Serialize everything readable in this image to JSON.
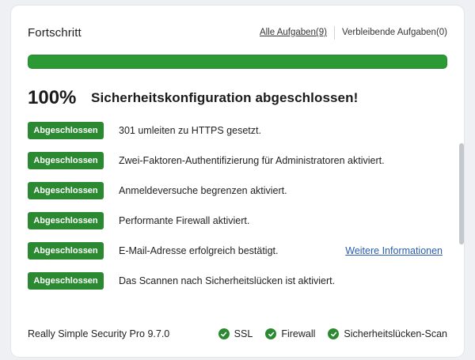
{
  "header": {
    "title": "Fortschritt",
    "filter_all": "Alle Aufgaben(9)",
    "filter_remaining": "Verbleibende Aufgaben(0)"
  },
  "progress": {
    "value_percent": 100,
    "percent_label": "100%",
    "summary": "Sicherheitskonfiguration abgeschlossen!",
    "bar_color": "#2b9a34"
  },
  "tasks": [
    {
      "status": "Abgeschlossen",
      "text": "301 umleiten zu HTTPS gesetzt."
    },
    {
      "status": "Abgeschlossen",
      "text": "Zwei-Faktoren-Authentifizierung für Administratoren aktiviert."
    },
    {
      "status": "Abgeschlossen",
      "text": "Anmeldeversuche begrenzen aktiviert."
    },
    {
      "status": "Abgeschlossen",
      "text": "Performante Firewall aktiviert."
    },
    {
      "status": "Abgeschlossen",
      "text": "E-Mail-Adresse erfolgreich bestätigt.",
      "link": "Weitere Informationen"
    },
    {
      "status": "Abgeschlossen",
      "text": "Das Scannen nach Sicherheitslücken ist aktiviert."
    }
  ],
  "footer": {
    "version": "Really Simple Security Pro 9.7.0",
    "statuses": [
      {
        "label": "SSL",
        "icon": "check-circle-icon"
      },
      {
        "label": "Firewall",
        "icon": "check-circle-icon"
      },
      {
        "label": "Sicherheitslücken-Scan",
        "icon": "check-circle-icon"
      }
    ]
  },
  "colors": {
    "accent_green": "#2b8a31",
    "link_blue": "#2a5db0"
  }
}
